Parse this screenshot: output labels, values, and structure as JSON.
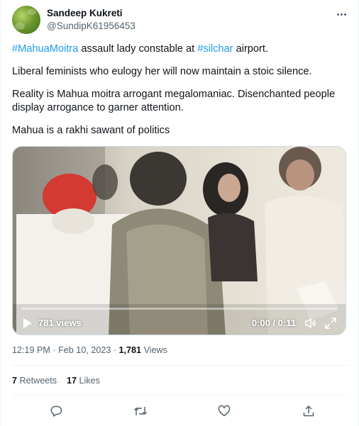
{
  "author": {
    "name": "Sandeep Kukreti",
    "handle": "@SundipK61956453"
  },
  "tweet": {
    "line1": {
      "tag1": "#MahuaMoitra",
      "mid": " assault lady constable at ",
      "tag2": "#silchar",
      "end": " airport."
    },
    "line2": "Liberal feminists who eulogy her will now maintain a stoic silence.",
    "line3": "Reality is Mahua moitra arrogant megalomaniac.   Disenchanted people display arrogance to garner attention.",
    "line4": "Mahua is a rakhi sawant of politics"
  },
  "video": {
    "views": "781 views",
    "time": "0:00 / 0:11",
    "progress": 0.0
  },
  "meta": {
    "time": "12:19 PM",
    "date": "Feb 10, 2023",
    "views_count": "1,781",
    "views_label": "Views"
  },
  "stats": {
    "retweets_count": "7",
    "retweets_label": "Retweets",
    "likes_count": "17",
    "likes_label": "Likes"
  },
  "colors": {
    "link": "#1d9bf0",
    "text": "#0f1419",
    "secondary": "#536471"
  },
  "icons": {
    "more": "more-icon",
    "reply": "reply-icon",
    "retweet": "retweet-icon",
    "like": "like-icon",
    "share": "share-icon",
    "play": "play-icon",
    "volume": "volume-icon",
    "fullscreen": "fullscreen-icon"
  }
}
